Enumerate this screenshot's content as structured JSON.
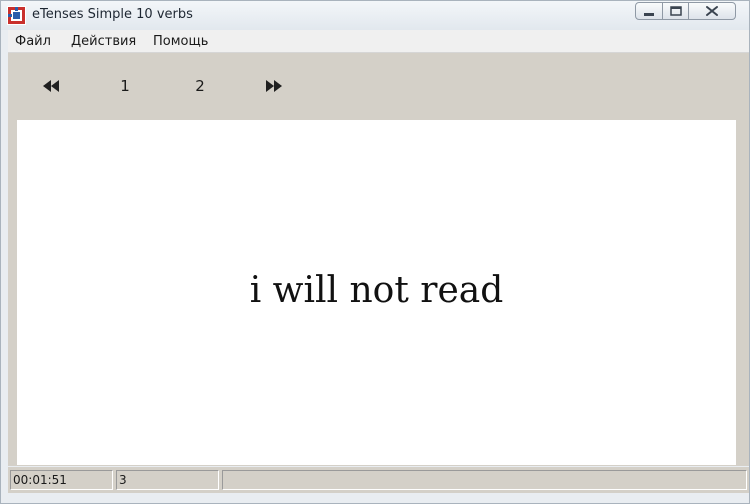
{
  "window": {
    "title": "eTenses Simple 10 verbs",
    "app_icon": "etenses-app-icon",
    "caption_buttons": [
      "minimize-icon",
      "restore-icon",
      "close-icon"
    ]
  },
  "menu": {
    "items": [
      {
        "label": "Файл"
      },
      {
        "label": "Действия"
      },
      {
        "label": "Помощь"
      }
    ]
  },
  "toolbar": {
    "prev_icon": "rewind-icon",
    "page_1": "1",
    "page_2": "2",
    "next_icon": "fast-forward-icon"
  },
  "main": {
    "sentence": "i will not read"
  },
  "statusbar": {
    "elapsed": "00:01:51",
    "count": "3",
    "message": ""
  },
  "colors": {
    "client_bg": "#d4d0c8",
    "content_bg": "#ffffff",
    "frame_bg": "#e9edf1"
  }
}
